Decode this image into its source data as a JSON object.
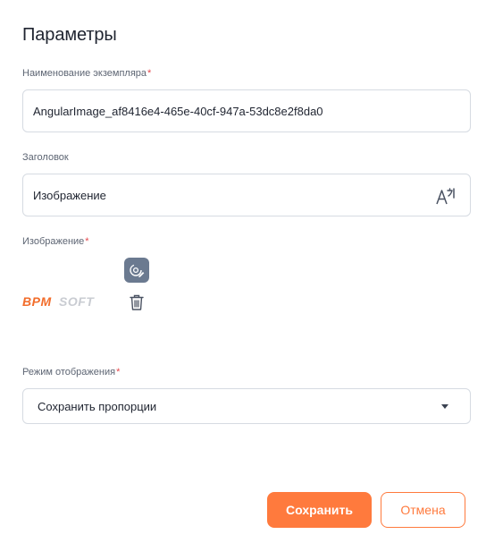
{
  "header": {
    "title": "Параметры"
  },
  "fields": {
    "instance_name": {
      "label": "Наименование экземпляра",
      "required_mark": "*",
      "value": "AngularImage_af8416e4-465e-40cf-947a-53dc8e2f8da0"
    },
    "caption": {
      "label": "Заголовок",
      "value": "Изображение"
    },
    "image": {
      "label": "Изображение",
      "required_mark": "*",
      "logo_text": "BPMSOFT"
    },
    "display_mode": {
      "label": "Режим отображения",
      "required_mark": "*",
      "value": "Сохранить пропорции"
    }
  },
  "actions": {
    "save_label": "Сохранить",
    "cancel_label": "Отмена"
  },
  "colors": {
    "accent": "#ff7a3d",
    "required": "#e5484d",
    "icon_button_bg": "#6b7a90",
    "border": "#d6dbe2"
  },
  "icons": {
    "translate": "translate-icon",
    "upload": "camera-edit-icon",
    "delete": "trash-icon",
    "dropdown": "chevron-down-icon"
  }
}
